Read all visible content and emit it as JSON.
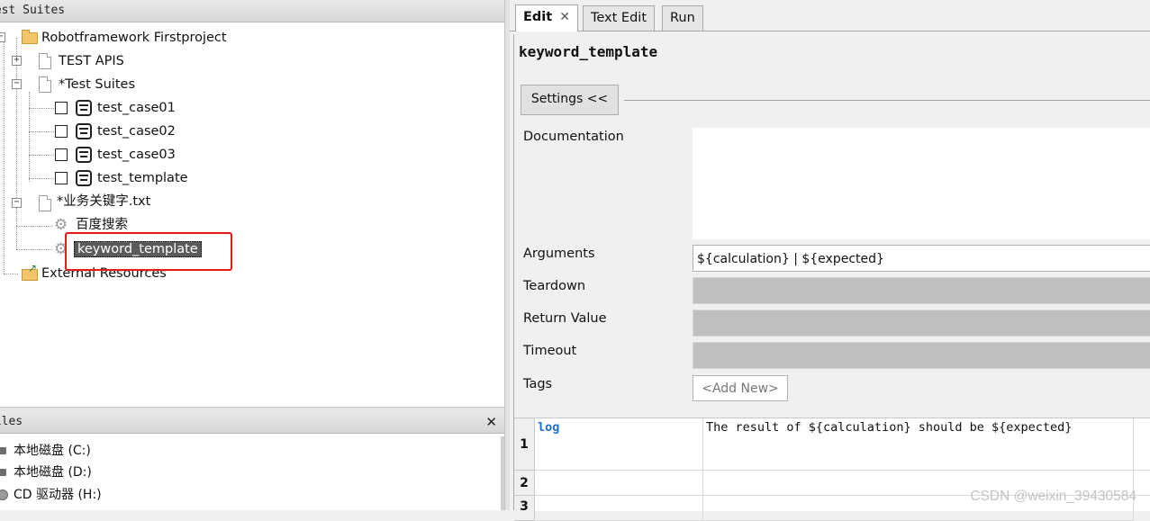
{
  "test_suites_panel": {
    "title": "Test Suites"
  },
  "tree": {
    "root": "Robotframework Firstproject",
    "test_apis": "TEST APIS",
    "test_suites": "*Test Suites",
    "test_cases": [
      "test_case01",
      "test_case02",
      "test_case03",
      "test_template"
    ],
    "resource_file": "*业务关键字.txt",
    "keywords": [
      "百度搜索",
      "keyword_template"
    ],
    "external": "External Resources"
  },
  "files_panel": {
    "title": "Files",
    "close": "✕",
    "drives": [
      "本地磁盘 (C:)",
      "本地磁盘 (D:)",
      "CD 驱动器 (H:)"
    ]
  },
  "tabs": {
    "edit": "Edit",
    "text_edit": "Text Edit",
    "run": "Run",
    "close": "✕"
  },
  "editor": {
    "keyword_name": "keyword_template",
    "settings_button": "Settings <<",
    "labels": {
      "documentation": "Documentation",
      "arguments": "Arguments",
      "teardown": "Teardown",
      "return_value": "Return Value",
      "timeout": "Timeout",
      "tags": "Tags"
    },
    "arguments_value": "${calculation} | ${expected}",
    "add_new": "<Add New>"
  },
  "grid": {
    "row_numbers": [
      "1",
      "2",
      "3"
    ],
    "rows": [
      [
        "log",
        "The result of ${calculation} should be ${expected}"
      ]
    ]
  },
  "watermark": "CSDN @weixin_39430584"
}
